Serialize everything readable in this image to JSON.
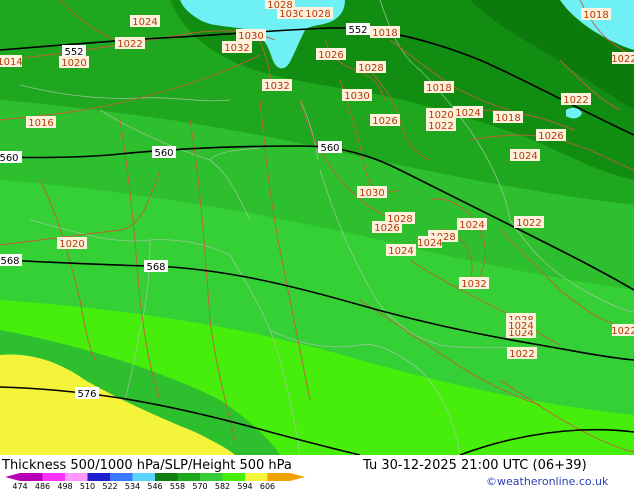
{
  "map": {
    "thickness_colors": {
      "deep": "#118d11",
      "dark": "#1fa81f",
      "mid": "#2dbf2d",
      "light": "#35d035",
      "bright": "#3de03d",
      "lime": "#47ee0b",
      "yellow": "#f4f43a",
      "water": "#6ef0f5",
      "isobar": "#c0603a",
      "height": "#000000",
      "border": "#a0a0a0"
    },
    "height_labels": [
      "552",
      "552",
      "560",
      "560",
      "560",
      "568",
      "568",
      "576"
    ],
    "isobar_labels": [
      "1024",
      "1022",
      "1020",
      "1014",
      "1030",
      "1030",
      "1028",
      "1032",
      "1026",
      "1028",
      "1032",
      "1030",
      "1026",
      "1028",
      "1026",
      "1018",
      "1018",
      "1018",
      "1022",
      "1020",
      "1022",
      "1024",
      "1016",
      "1020",
      "1024",
      "1024",
      "1022",
      "1028",
      "1030",
      "1032",
      "1018",
      "1026",
      "1028",
      "1024",
      "1024",
      "1022",
      "1022",
      "1028",
      "1024",
      "1022",
      "1024"
    ]
  },
  "footer": {
    "title": "Thickness 500/1000 hPa/SLP/Height 500 hPa",
    "datetime": "Tu 30-12-2025 21:00 UTC (06+39)",
    "credit": "©weatheronline.co.uk",
    "colorbar": {
      "labels": [
        "474",
        "486",
        "498",
        "510",
        "522",
        "534",
        "546",
        "558",
        "570",
        "582",
        "594",
        "606"
      ],
      "colors": [
        "#b500b5",
        "#ff33ff",
        "#ff99ff",
        "#1f1fd0",
        "#3b77ff",
        "#5ad3ff",
        "#0f7d0f",
        "#1fa81f",
        "#35cc35",
        "#47ee0b",
        "#f4f43a",
        "#f0a200"
      ]
    }
  }
}
